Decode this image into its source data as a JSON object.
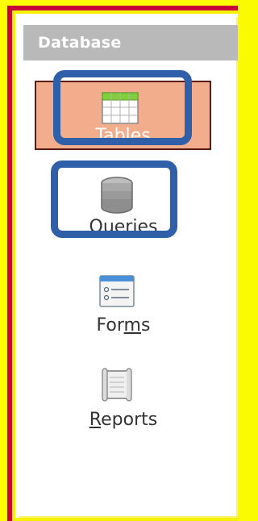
{
  "panel": {
    "title": "Database",
    "items": [
      {
        "label": "Tables",
        "mnemonic": "",
        "icon": "table-icon",
        "selected": true
      },
      {
        "label": "Queries",
        "mnemonic": "Q",
        "icon": "database-icon",
        "selected": false
      },
      {
        "label_pre": "For",
        "label_mn": "m",
        "label_post": "s",
        "icon": "form-icon",
        "selected": false
      },
      {
        "label_pre": "",
        "label_mn": "R",
        "label_post": "eports",
        "icon": "report-icon",
        "selected": false
      }
    ]
  },
  "colors": {
    "background": "#ffff00",
    "border": "#c8003a",
    "header": "#b9b9b9",
    "selected": "#f2ad8d",
    "highlight": "#2e5fa8"
  }
}
